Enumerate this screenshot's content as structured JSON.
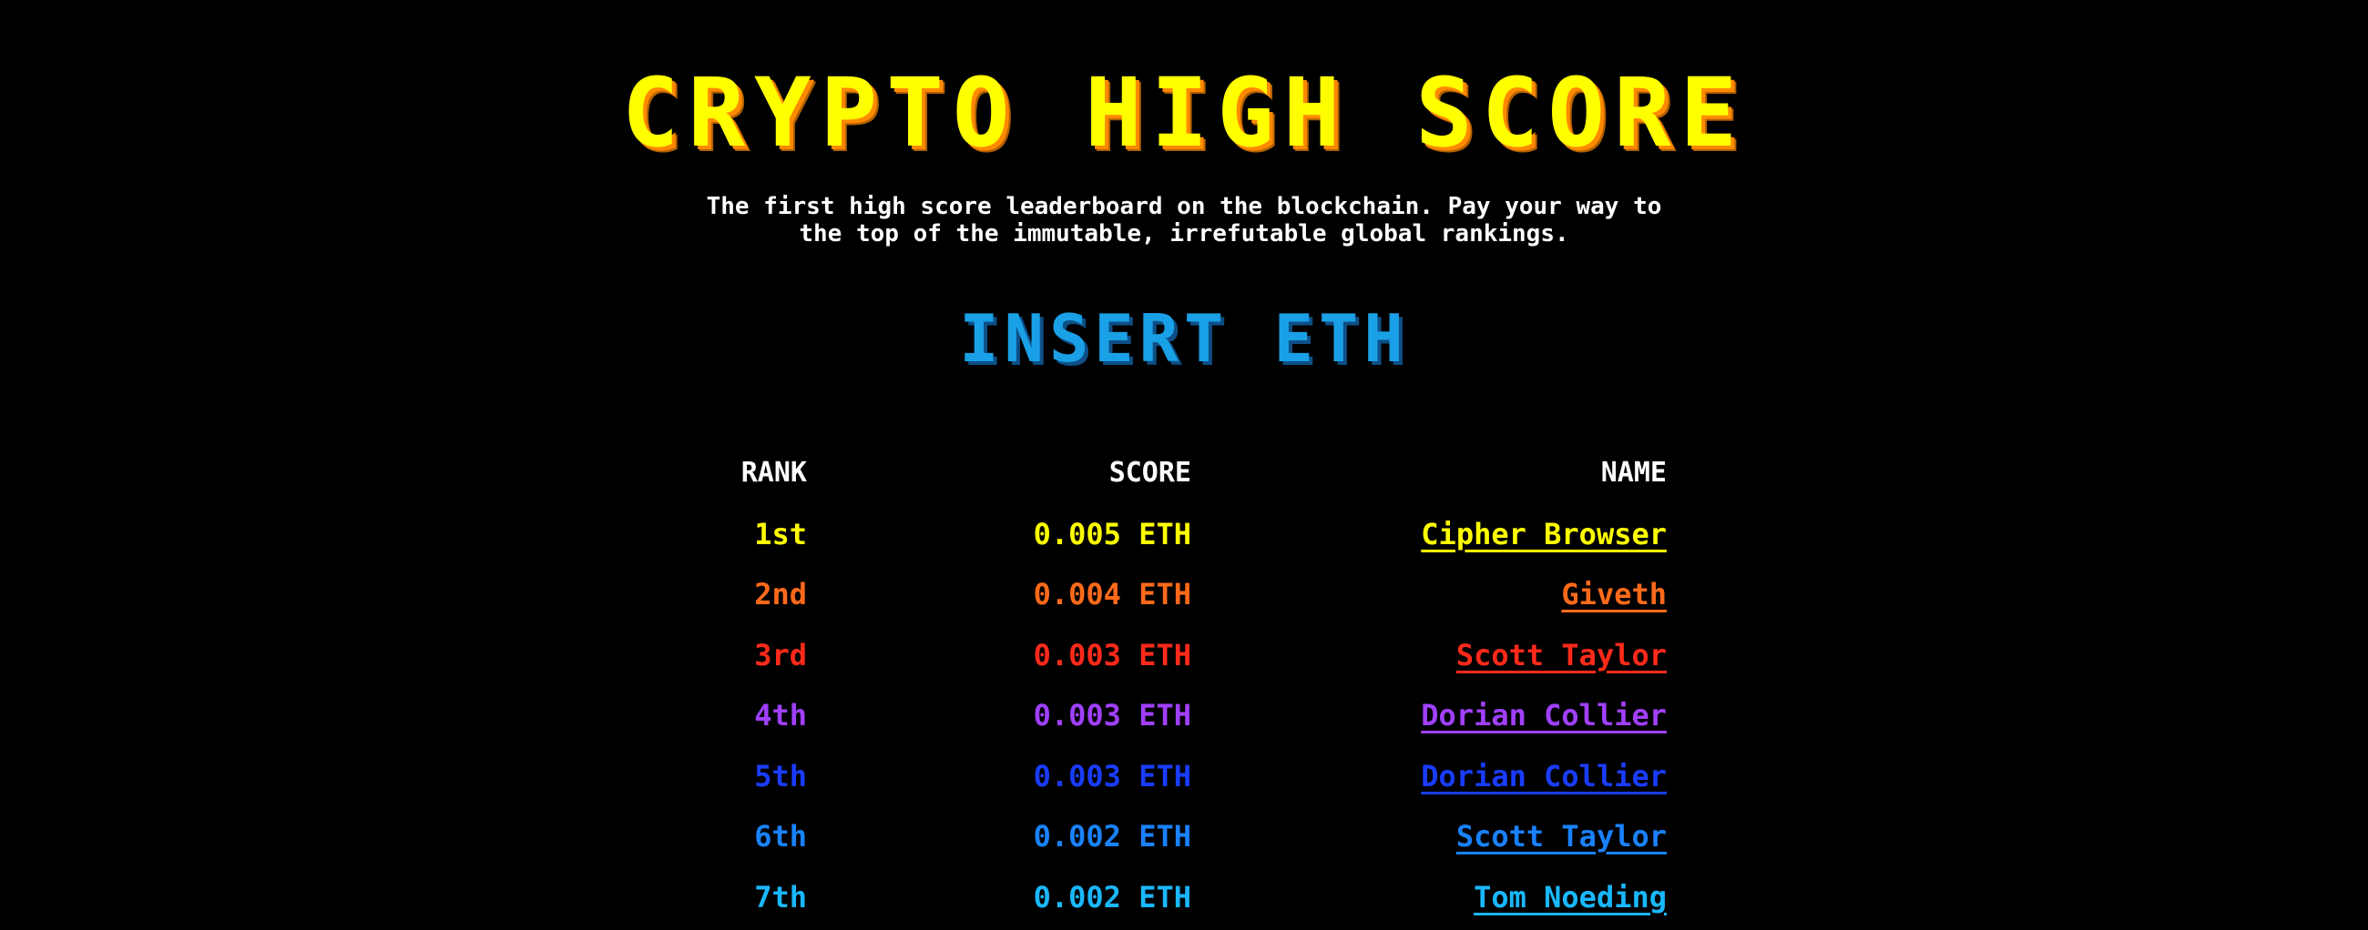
{
  "header": {
    "title": "CRYPTO HIGH SCORE",
    "subtitle_line1": "The first high score leaderboard on the blockchain. Pay your way to",
    "subtitle_line2": "the top of the immutable, irrefutable global rankings."
  },
  "cta": {
    "label": "INSERT ETH"
  },
  "leaderboard": {
    "columns": {
      "rank": "RANK",
      "score": "SCORE",
      "name": "NAME"
    },
    "rows": [
      {
        "rank": "1st",
        "score": "0.005 ETH",
        "name": "Cipher Browser",
        "color": "#ffff00"
      },
      {
        "rank": "2nd",
        "score": "0.004 ETH",
        "name": "Giveth",
        "color": "#ff6a1a"
      },
      {
        "rank": "3rd",
        "score": "0.003 ETH",
        "name": "Scott Taylor",
        "color": "#ff2a1a"
      },
      {
        "rank": "4th",
        "score": "0.003 ETH",
        "name": "Dorian Collier",
        "color": "#a040ff"
      },
      {
        "rank": "5th",
        "score": "0.003 ETH",
        "name": "Dorian Collier",
        "color": "#1a3cff"
      },
      {
        "rank": "6th",
        "score": "0.002 ETH",
        "name": "Scott Taylor",
        "color": "#1a82ff"
      },
      {
        "rank": "7th",
        "score": "0.002 ETH",
        "name": "Tom Noeding",
        "color": "#1ab8ff"
      }
    ]
  }
}
